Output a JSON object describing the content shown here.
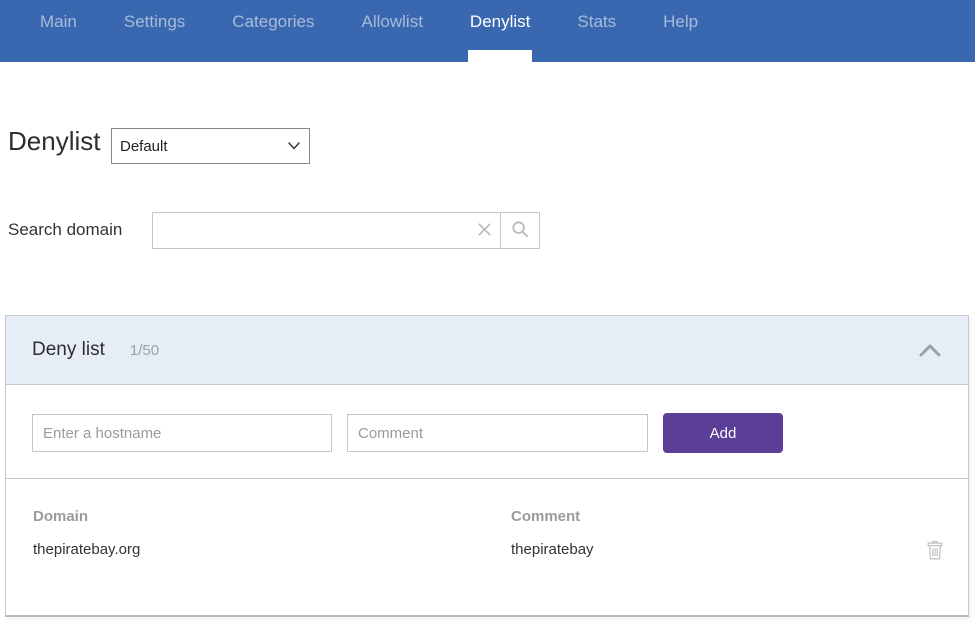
{
  "nav": {
    "items": [
      {
        "label": "Main",
        "active": false
      },
      {
        "label": "Settings",
        "active": false
      },
      {
        "label": "Categories",
        "active": false
      },
      {
        "label": "Allowlist",
        "active": false
      },
      {
        "label": "Denylist",
        "active": true
      },
      {
        "label": "Stats",
        "active": false
      },
      {
        "label": "Help",
        "active": false
      }
    ]
  },
  "page": {
    "title": "Denylist",
    "list_selector": {
      "selected": "Default"
    },
    "search": {
      "label": "Search domain",
      "value": "",
      "placeholder": ""
    }
  },
  "panel": {
    "title": "Deny list",
    "count": "1/50",
    "form": {
      "hostname_placeholder": "Enter a hostname",
      "comment_placeholder": "Comment",
      "add_label": "Add"
    },
    "table": {
      "columns": [
        "Domain",
        "Comment"
      ],
      "rows": [
        {
          "domain": "thepiratebay.org",
          "comment": "thepiratebay"
        }
      ]
    }
  },
  "icons": {
    "clear": "x-icon",
    "search": "magnifier-icon",
    "collapse": "chevron-up-icon",
    "select": "chevron-down-icon",
    "delete": "trash-icon"
  },
  "colors": {
    "nav_bg": "#3a68b0",
    "nav_inactive": "#a7bbd9",
    "nav_active": "#ffffff",
    "panel_header_bg": "#e7edf7",
    "accent_purple": "#5b3f96",
    "border_gray": "#c9c9c9",
    "muted_text": "#9a9a9a",
    "dark_text": "#333333"
  }
}
